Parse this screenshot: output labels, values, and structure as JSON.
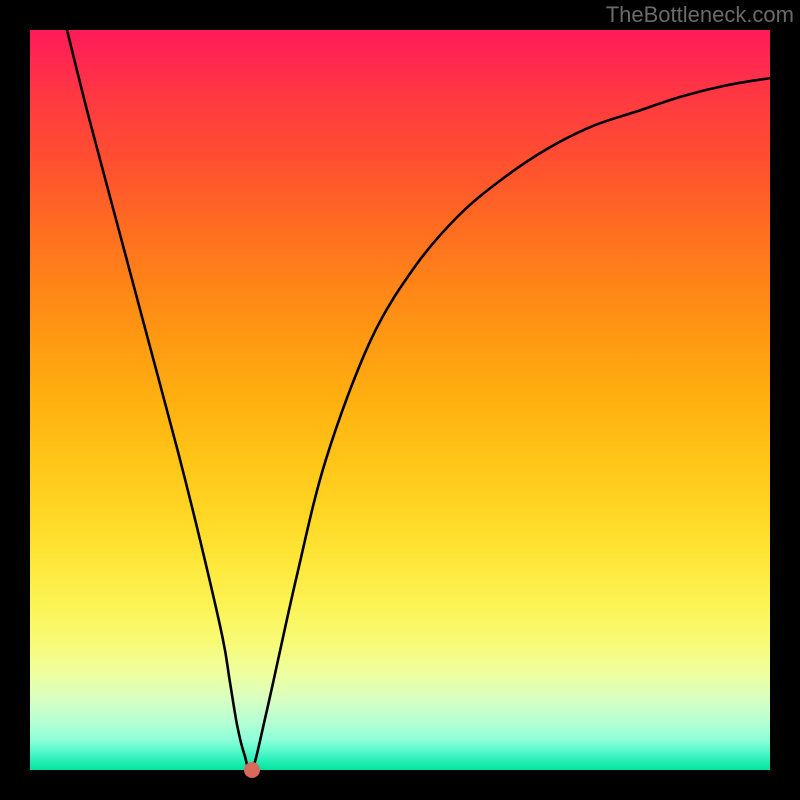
{
  "watermark": "TheBottleneck.com",
  "chart_data": {
    "type": "line",
    "title": "",
    "xlabel": "",
    "ylabel": "",
    "xlim": [
      0,
      100
    ],
    "ylim": [
      0,
      100
    ],
    "series": [
      {
        "name": "curve",
        "x": [
          5,
          8,
          12,
          16,
          20,
          23,
          26,
          27,
          28,
          29,
          30,
          32,
          36,
          40,
          46,
          52,
          58,
          64,
          70,
          76,
          82,
          88,
          94,
          100
        ],
        "y": [
          100,
          88,
          73,
          58,
          43,
          31,
          18,
          12,
          6,
          2,
          0,
          8,
          26,
          42,
          58,
          68,
          75,
          80,
          84,
          87,
          89,
          91,
          92.5,
          93.5
        ]
      }
    ],
    "marker": {
      "x": 30,
      "y": 0,
      "color": "#d86a5a"
    },
    "background_gradient": {
      "top": "#ff1a58",
      "bottom": "#00e49e"
    }
  }
}
